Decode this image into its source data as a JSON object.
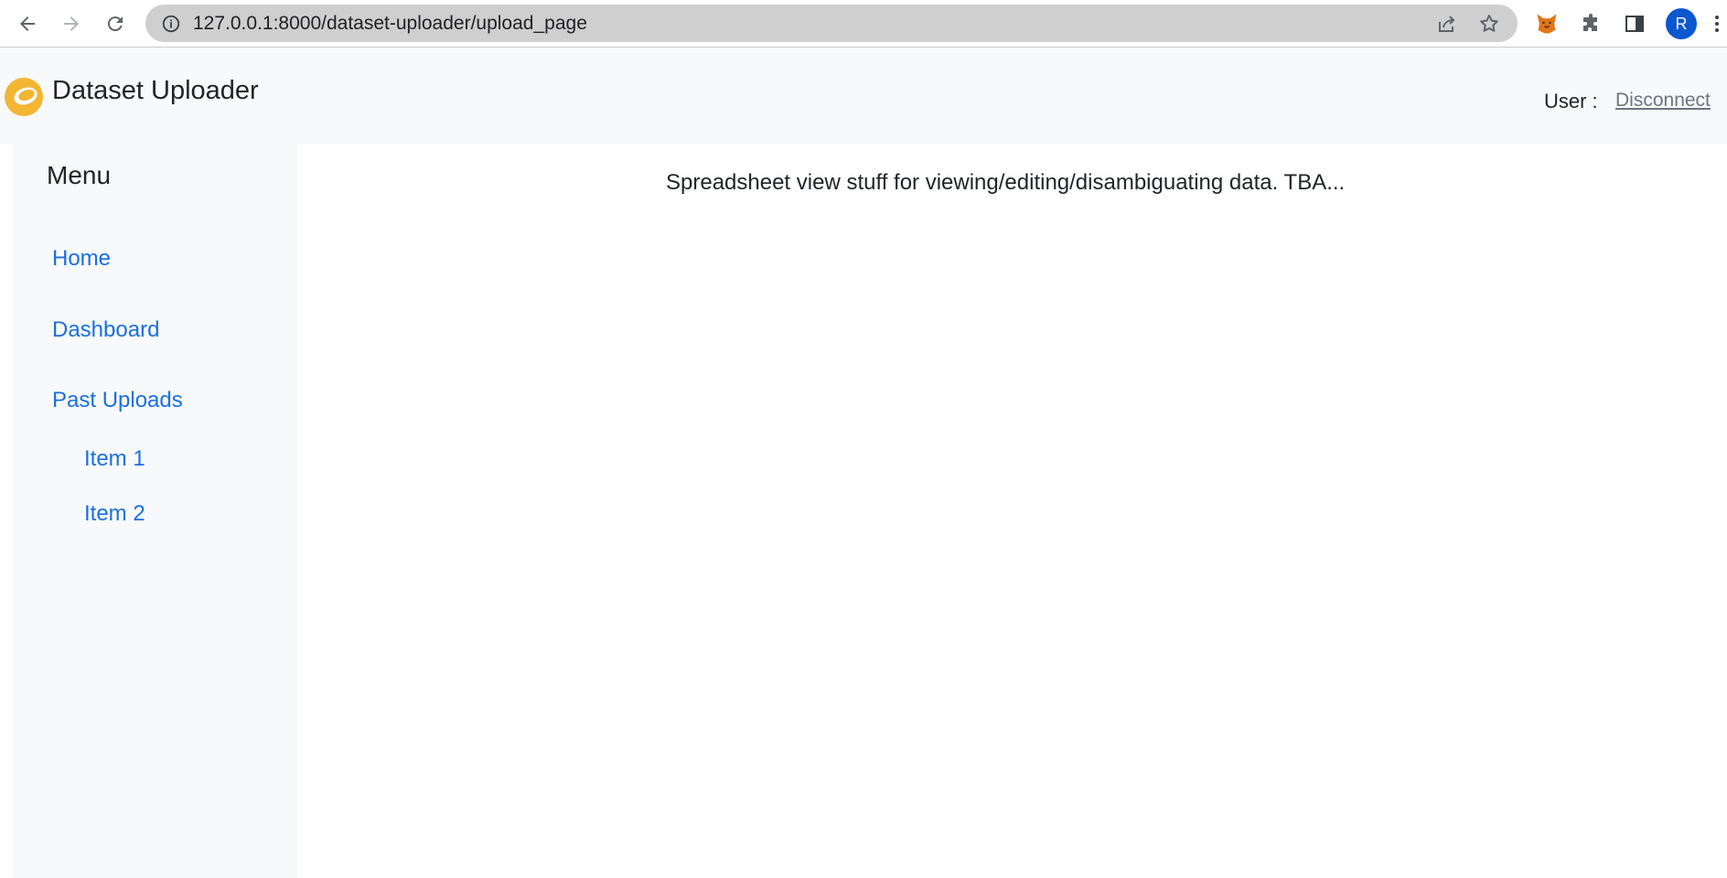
{
  "browser": {
    "url": "127.0.0.1:8000/dataset-uploader/upload_page",
    "profile_initial": "R",
    "icons": [
      "back-icon",
      "forward-icon",
      "reload-icon",
      "info-icon",
      "share-icon",
      "star-icon",
      "fox-extension-icon",
      "puzzle-icon",
      "sidepanel-icon",
      "more-icon"
    ]
  },
  "header": {
    "title": "Dataset Uploader",
    "user_label": "User :",
    "disconnect_label": "Disconnect",
    "logo_color": "#f2b632"
  },
  "sidebar": {
    "title": "Menu",
    "items": [
      {
        "label": "Home"
      },
      {
        "label": "Dashboard"
      },
      {
        "label": "Past Uploads"
      }
    ],
    "sub_items": [
      {
        "label": "Item 1"
      },
      {
        "label": "Item 2"
      }
    ],
    "link_color": "#1a6fe0"
  },
  "main": {
    "message": "Spreadsheet view stuff for viewing/editing/disambiguating data. TBA..."
  }
}
